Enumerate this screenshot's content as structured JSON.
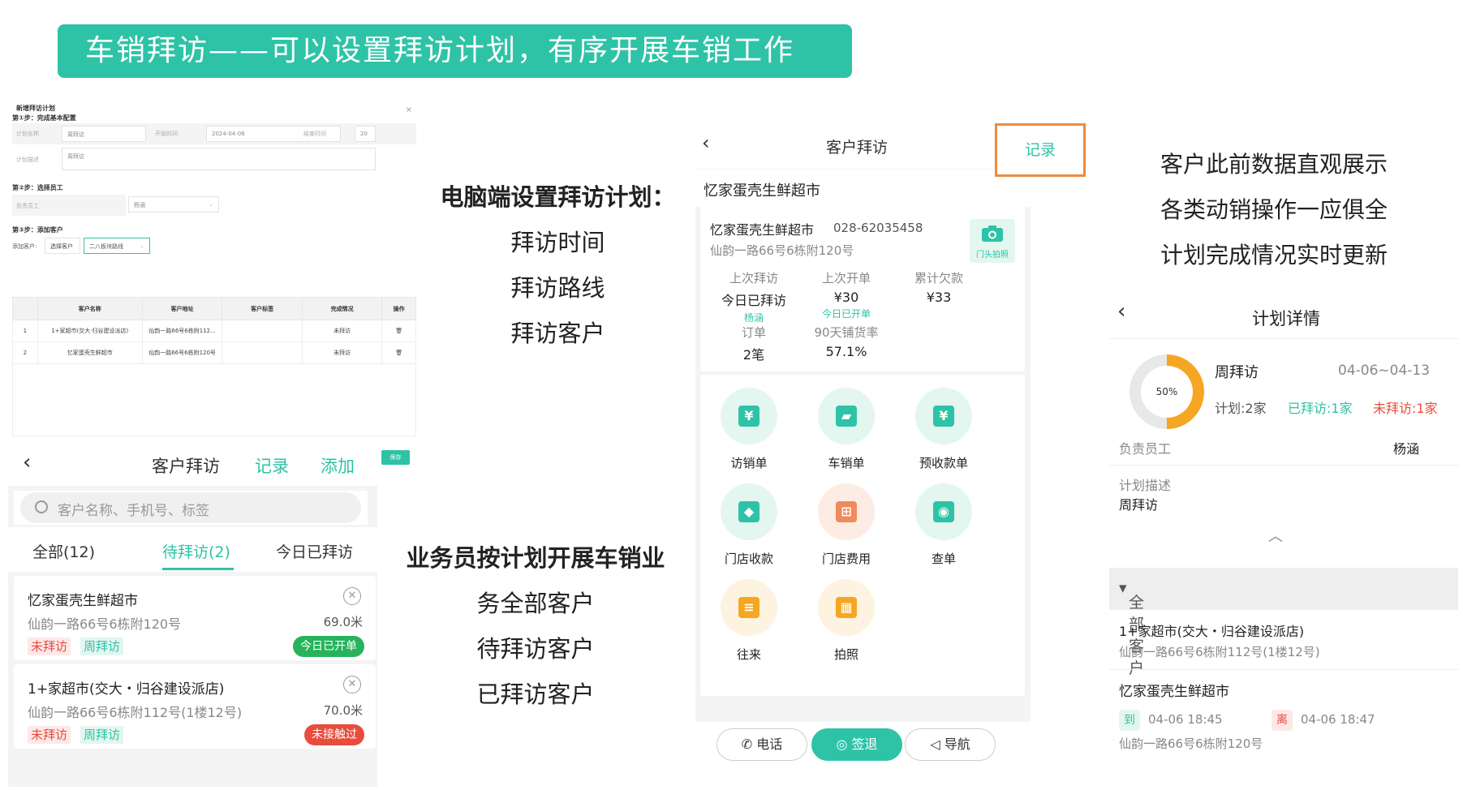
{
  "banner": {
    "title": "车销拜访——可以设置拜访计划，有序开展车销工作"
  },
  "pc_form": {
    "title": "新增拜访计划",
    "close": "×",
    "step1": "第①步：完成基本配置",
    "plan_name_label": "计划名称",
    "plan_name_value": "周拜访",
    "start_label": "开始时间",
    "start_value": "2024-04-06",
    "end_label": "结束时间",
    "end_value": "20",
    "desc_label": "计划描述",
    "desc_value": "周拜访",
    "step2": "第②步：选择员工",
    "employee_label": "负责员工",
    "employee_value": "杨涵",
    "step3": "第③步：添加客户",
    "add_customer_label": "添加客户:",
    "select_customer": "选择客户",
    "route_select": "二八板块路线",
    "columns": [
      "客户名称",
      "客户地址",
      "客户标签",
      "完成情况",
      "操作"
    ],
    "rows": [
      {
        "idx": "1",
        "name": "1+家超市(交大·归谷建设派店)",
        "addr": "仙韵一路66号6栋附112...",
        "tag": "",
        "status": "未拜访"
      },
      {
        "idx": "2",
        "name": "忆家蛋壳生鲜超市",
        "addr": "仙韵一路66号6栋附120号",
        "tag": "",
        "status": "未拜访"
      }
    ],
    "save": "保存"
  },
  "left_phone": {
    "title": "客户拜访",
    "record": "记录",
    "add": "添加",
    "search_placeholder": "客户名称、手机号、标签",
    "tabs": [
      "全部(12)",
      "待拜访(2)",
      "今日已拜访"
    ],
    "cards": [
      {
        "name": "忆家蛋壳生鲜超市",
        "address": "仙韵一路66号6栋附120号",
        "distance": "69.0米",
        "tag1": "未拜访",
        "tag2": "周拜访",
        "pill": "今日已开单",
        "pill_color": "#27b35c"
      },
      {
        "name": "1+家超市(交大・归谷建设派店)",
        "address": "仙韵一路66号6栋附112号(1楼12号)",
        "distance": "70.0米",
        "tag1": "未拜访",
        "tag2": "周拜访",
        "pill": "未接触过",
        "pill_color": "#e74c3c"
      }
    ]
  },
  "center_top": {
    "heading": "电脑端设置拜访计划：",
    "items": [
      "拜访时间",
      "拜访路线",
      "拜访客户"
    ]
  },
  "center_bottom": {
    "lines": [
      "业务员按计划开展车销业",
      "务全部客户",
      "待拜访客户",
      "已拜访客户"
    ]
  },
  "mid_phone": {
    "title": "客户拜访",
    "record": "记录",
    "shop": "忆家蛋壳生鲜超市",
    "info_name": "忆家蛋壳生鲜超市",
    "phone": "028-62035458",
    "address": "仙韵一路66号6栋附120号",
    "camera_label": "门头拍照",
    "stats": [
      {
        "k": "上次拜访",
        "v": "今日已拜访",
        "s": "杨涵"
      },
      {
        "k": "上次开单",
        "v": "¥30",
        "s": "今日已开单"
      },
      {
        "k": "累计欠款",
        "v": "¥33",
        "s": ""
      },
      {
        "k": "订单",
        "v": "2笔",
        "s": ""
      },
      {
        "k": "90天铺货率",
        "v": "57.1%",
        "s": ""
      }
    ],
    "actions": [
      {
        "label": "访销单",
        "icon": "¥",
        "bg": "#e3f6f0",
        "fg": "#2ec3a6"
      },
      {
        "label": "车销单",
        "icon": "▰",
        "bg": "#e3f6f0",
        "fg": "#2ec3a6"
      },
      {
        "label": "预收款单",
        "icon": "¥",
        "bg": "#e3f6f0",
        "fg": "#2ec3a6"
      },
      {
        "label": "门店收款",
        "icon": "◆",
        "bg": "#e3f6f0",
        "fg": "#2ec3a6"
      },
      {
        "label": "门店费用",
        "icon": "⊞",
        "bg": "#fdece4",
        "fg": "#f08a5c"
      },
      {
        "label": "查单",
        "icon": "◉",
        "bg": "#e3f6f0",
        "fg": "#2ec3a6"
      },
      {
        "label": "往来",
        "icon": "≡",
        "bg": "#fdf3e0",
        "fg": "#f5a623"
      },
      {
        "label": "拍照",
        "icon": "▦",
        "bg": "#fdf3e0",
        "fg": "#f5a623"
      }
    ],
    "btn_call": "电话",
    "btn_checkout": "签退",
    "btn_nav": "导航"
  },
  "right_text": {
    "lines": [
      "客户此前数据直观展示",
      "各类动销操作一应俱全",
      "计划完成情况实时更新"
    ]
  },
  "right_phone": {
    "title": "计划详情",
    "percent": "50%",
    "progress": 0.5,
    "plan_name": "周拜访",
    "date_range": "04-06~04-13",
    "plan_count": "计划:2家",
    "visited": "已拜访:1家",
    "unvisited": "未拜访:1家",
    "employee_label": "负责员工",
    "employee": "杨涵",
    "desc_label": "计划描述",
    "desc": "周拜访",
    "section": "全部客户",
    "customers": [
      {
        "name": "1+家超市(交大・归谷建设派店)",
        "address": "仙韵一路66号6栋附112号(1楼12号)"
      },
      {
        "name": "忆家蛋壳生鲜超市",
        "arrive_tag": "到",
        "arrive": "04-06 18:45",
        "leave_tag": "离",
        "leave": "04-06 18:47",
        "address": "仙韵一路66号6栋附120号"
      }
    ]
  }
}
